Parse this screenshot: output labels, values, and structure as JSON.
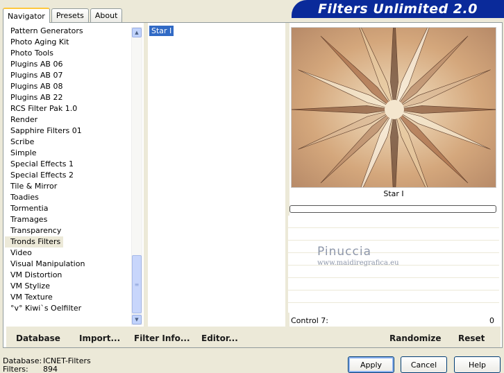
{
  "tabs": [
    "Navigator",
    "Presets",
    "About"
  ],
  "banner_title": "Filters Unlimited 2.0",
  "categories": [
    "Pattern Generators",
    "Photo Aging Kit",
    "Photo Tools",
    "Plugins AB 06",
    "Plugins AB 07",
    "Plugins AB 08",
    "Plugins AB 22",
    "RCS Filter Pak 1.0",
    "Render",
    "Sapphire Filters 01",
    "Scribe",
    "Simple",
    "Special Effects 1",
    "Special Effects 2",
    "Tile & Mirror",
    "Toadies",
    "Tormentia",
    "Tramages",
    "Transparency",
    "Tronds Filters",
    "Video",
    "Visual Manipulation",
    "VM Distortion",
    "VM Stylize",
    "VM Texture",
    "°v° Kiwi`s Oelfilter"
  ],
  "selected_category": "Tronds Filters",
  "filters": [
    "Star I"
  ],
  "selected_filter": "Star I",
  "preview_name": "Star I",
  "watermark": {
    "name": "Pinuccia",
    "url": "www.maidiregrafica.eu"
  },
  "control": {
    "label": "Control 7:",
    "value": "0"
  },
  "toolbar": {
    "database": "Database",
    "import": "Import...",
    "filter_info": "Filter Info...",
    "editor": "Editor...",
    "randomize": "Randomize",
    "reset": "Reset"
  },
  "status": {
    "db_key": "Database:",
    "db_value": "ICNET-Filters",
    "filters_key": "Filters:",
    "filters_value": "894"
  },
  "buttons": {
    "apply": "Apply",
    "cancel": "Cancel",
    "help": "Help"
  },
  "colors": {
    "banner": "#0A2A9A",
    "selection": "#316AC5",
    "dialog_bg": "#ECE9D8"
  }
}
